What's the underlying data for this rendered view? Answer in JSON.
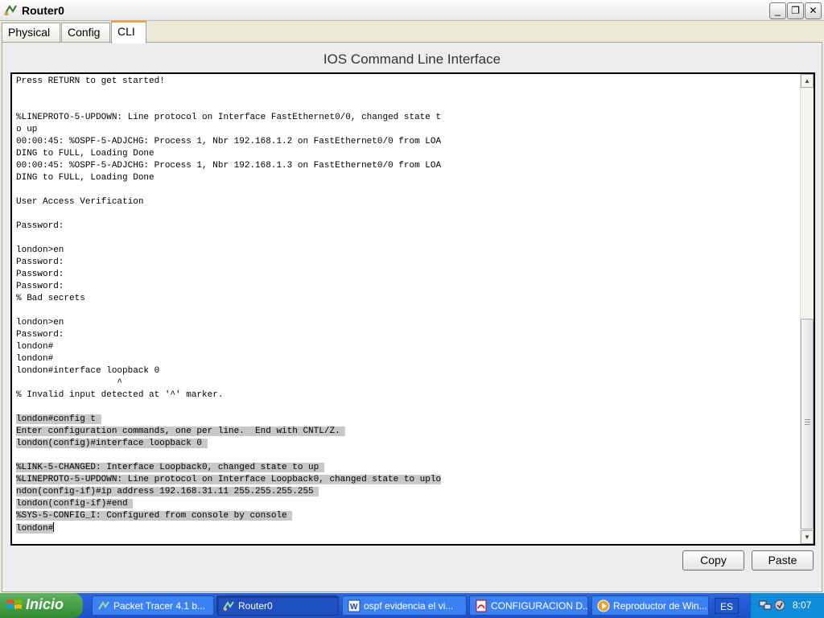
{
  "window": {
    "title": "Router0"
  },
  "window_controls": {
    "minimize": "_",
    "maximize": "❐",
    "close": "✕"
  },
  "tabs": [
    {
      "label": "Physical"
    },
    {
      "label": "Config"
    },
    {
      "label": "CLI"
    }
  ],
  "active_tab": "CLI",
  "cli": {
    "title": "IOS Command Line Interface",
    "lines": [
      {
        "text": "Press RETURN to get started!",
        "selected": false
      },
      {
        "text": "",
        "selected": false
      },
      {
        "text": "",
        "selected": false
      },
      {
        "text": "%LINEPROTO-5-UPDOWN: Line protocol on Interface FastEthernet0/0, changed state t",
        "selected": false
      },
      {
        "text": "o up",
        "selected": false
      },
      {
        "text": "00:00:45: %OSPF-5-ADJCHG: Process 1, Nbr 192.168.1.2 on FastEthernet0/0 from LOA",
        "selected": false
      },
      {
        "text": "DING to FULL, Loading Done",
        "selected": false
      },
      {
        "text": "00:00:45: %OSPF-5-ADJCHG: Process 1, Nbr 192.168.1.3 on FastEthernet0/0 from LOA",
        "selected": false
      },
      {
        "text": "DING to FULL, Loading Done",
        "selected": false
      },
      {
        "text": "",
        "selected": false
      },
      {
        "text": "User Access Verification",
        "selected": false
      },
      {
        "text": "",
        "selected": false
      },
      {
        "text": "Password:",
        "selected": false
      },
      {
        "text": "",
        "selected": false
      },
      {
        "text": "london>en",
        "selected": false
      },
      {
        "text": "Password:",
        "selected": false
      },
      {
        "text": "Password:",
        "selected": false
      },
      {
        "text": "Password:",
        "selected": false
      },
      {
        "text": "% Bad secrets",
        "selected": false
      },
      {
        "text": "",
        "selected": false
      },
      {
        "text": "london>en",
        "selected": false
      },
      {
        "text": "Password:",
        "selected": false
      },
      {
        "text": "london#",
        "selected": false
      },
      {
        "text": "london#",
        "selected": false
      },
      {
        "text": "london#interface loopback 0",
        "selected": false
      },
      {
        "text": "                   ^",
        "selected": false
      },
      {
        "text": "% Invalid input detected at '^' marker.",
        "selected": false
      },
      {
        "text": "",
        "selected": false
      },
      {
        "text": "london#config t ",
        "selected": true
      },
      {
        "text": "Enter configuration commands, one per line.  End with CNTL/Z. ",
        "selected": true
      },
      {
        "text": "london(config)#interface loopback 0 ",
        "selected": true
      },
      {
        "text": "",
        "selected": false
      },
      {
        "text": "%LINK-5-CHANGED: Interface Loopback0, changed state to up ",
        "selected": true
      },
      {
        "text": "%LINEPROTO-5-UPDOWN: Line protocol on Interface Loopback0, changed state to uplo",
        "selected": true
      },
      {
        "text": "ndon(config-if)#ip address 192.168.31.11 255.255.255.255 ",
        "selected": true
      },
      {
        "text": "london(config-if)#end ",
        "selected": true
      },
      {
        "text": "%SYS-5-CONFIG_I: Configured from console by console ",
        "selected": true
      },
      {
        "text": "london#",
        "selected": true,
        "cursor": true
      }
    ]
  },
  "buttons": {
    "copy": "Copy",
    "paste": "Paste"
  },
  "scrollbar": {
    "up": "▲",
    "down": "▼"
  },
  "taskbar": {
    "start_label": "Inicio",
    "tasks": [
      {
        "label": "Packet Tracer 4.1 b...",
        "icon": "packet-tracer-icon",
        "active": false
      },
      {
        "label": "Router0",
        "icon": "router-icon",
        "active": true
      },
      {
        "label": "ospf  evidencia el vi...",
        "icon": "word-icon",
        "active": false
      },
      {
        "label": "CONFIGURACION D...",
        "icon": "pdf-icon",
        "active": false
      },
      {
        "label": "Reproductor de Win...",
        "icon": "media-player-icon",
        "active": false
      }
    ],
    "language": "ES",
    "clock": "8:07"
  },
  "colors": {
    "selection": "#c8c8c8",
    "active_tab_accent": "#f0a030",
    "taskbar": "#245edb",
    "start_button": "#3c9a3c",
    "tray": "#0f8bdc"
  }
}
